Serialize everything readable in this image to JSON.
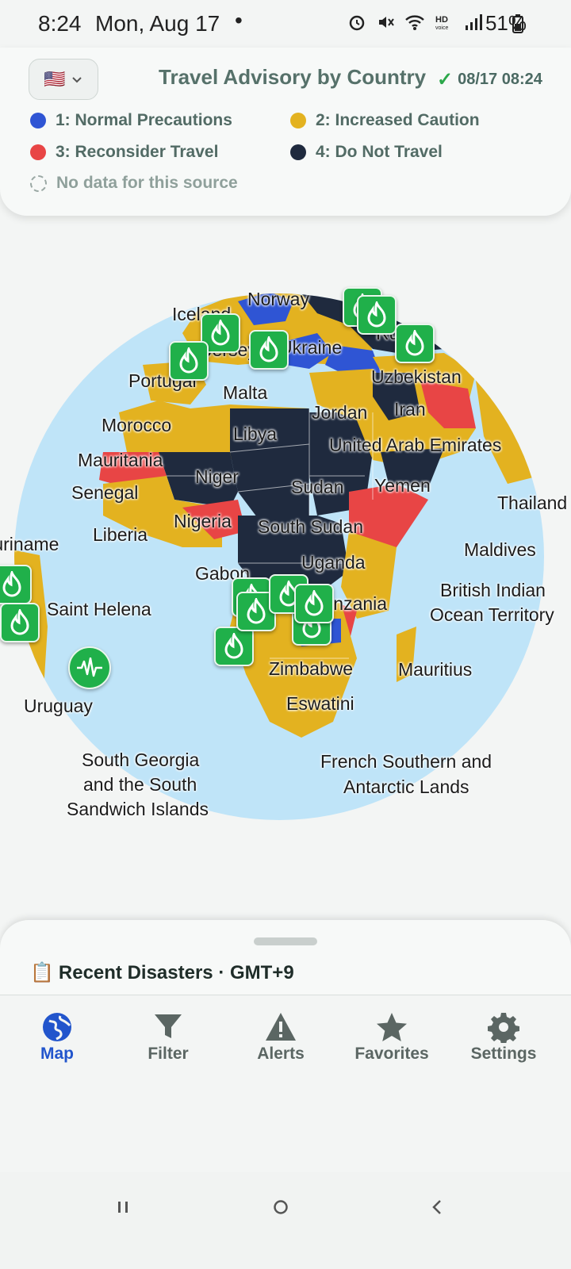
{
  "status_bar": {
    "time": "8:24",
    "date": "Mon, Aug 17",
    "dot": "•",
    "battery": "51%",
    "icons": [
      "alarm-icon",
      "mute-icon",
      "wifi-icon",
      "hd-voice-icon",
      "signal-icon",
      "battery-icon"
    ]
  },
  "header": {
    "flag": "🇺🇸",
    "title": "Travel Advisory by Country",
    "updated": "08/17 08:24",
    "check": "✓"
  },
  "legend": [
    {
      "label": "1: Normal Precautions",
      "color": "#2f55d4"
    },
    {
      "label": "2: Increased Caution",
      "color": "#e3b220"
    },
    {
      "label": "3: Reconsider Travel",
      "color": "#e84545"
    },
    {
      "label": "4: Do Not Travel",
      "color": "#1f2a3e"
    },
    {
      "label": "No data for this source",
      "color": "none"
    }
  ],
  "map": {
    "ocean_color": "#bfe4f8",
    "labels": {
      "iceland": "Iceland",
      "norway": "Norway",
      "jersey": "Jersey",
      "ukraine": "Ukraine",
      "russia": "Russia",
      "portugal": "Portugal",
      "uzbekistan": "Uzbekistan",
      "malta": "Malta",
      "morocco": "Morocco",
      "jordan": "Jordan",
      "iran": "Iran",
      "libya": "Libya",
      "uae": "United Arab Emirates",
      "mauritania": "Mauritania",
      "niger": "Niger",
      "senegal": "Senegal",
      "sudan": "Sudan",
      "yemen": "Yemen",
      "thailand": "Thailand",
      "nigeria": "Nigeria",
      "liberia": "Liberia",
      "south_sudan": "South Sudan",
      "suriname": "Suriname",
      "maldives": "Maldives",
      "uganda": "Uganda",
      "gabon": "Gabon",
      "biot1": "British Indian",
      "biot2": "Ocean Territory",
      "saint_helena": "Saint Helena",
      "tanzania": "Tanzania",
      "zimbabwe": "Zimbabwe",
      "mauritius": "Mauritius",
      "uruguay": "Uruguay",
      "eswatini": "Eswatini",
      "sgeorgia1": "South Georgia",
      "sgeorgia2": "and the South",
      "sgeorgia3": "Sandwich Islands",
      "fsal1": "French Southern and",
      "fsal2": "Antarctic Lands"
    }
  },
  "sheet": {
    "icon": "📋",
    "title": "Recent Disasters · GMT+9"
  },
  "nav": {
    "map": "Map",
    "filter": "Filter",
    "alerts": "Alerts",
    "favorites": "Favorites",
    "settings": "Settings",
    "active_color": "#2255cc"
  }
}
